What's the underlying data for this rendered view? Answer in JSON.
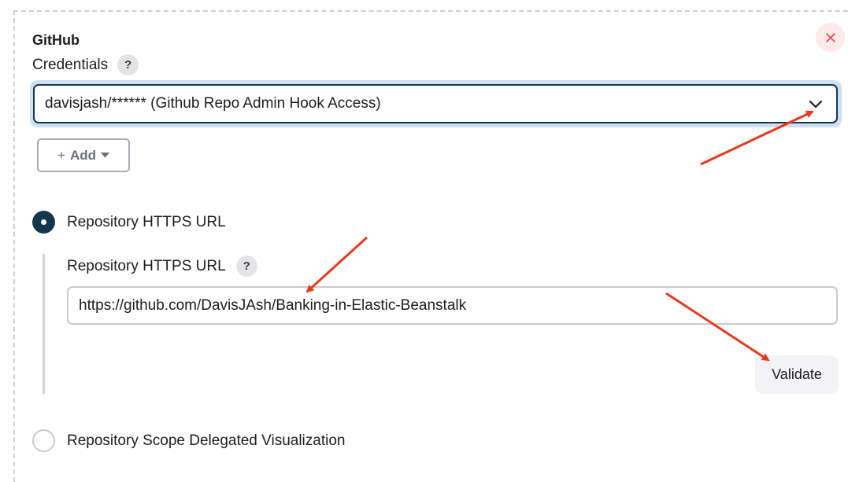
{
  "section": {
    "title": "GitHub",
    "close_icon": "close-x-icon",
    "accent_color": "#14374f",
    "close_color": "#e5484d"
  },
  "credentials": {
    "label": "Credentials",
    "help": "?",
    "selected_value": "davisjash/****** (Github Repo Admin Hook Access)",
    "dropdown_icon": "chevron-down-icon",
    "add_button": {
      "prefix": "+",
      "label": "Add",
      "icon": "caret-down-icon"
    }
  },
  "repository": {
    "https_option_label": "Repository HTTPS URL",
    "https_selected": true,
    "url_field_label": "Repository HTTPS URL",
    "url_help": "?",
    "url_value": "https://github.com/DavisJAsh/Banking-in-Elastic-Beanstalk",
    "validate_label": "Validate",
    "next_option_label": "Repository Scope Delegated Visualization"
  },
  "annotations": {
    "arrow_color": "#e8391d",
    "count": 3
  }
}
